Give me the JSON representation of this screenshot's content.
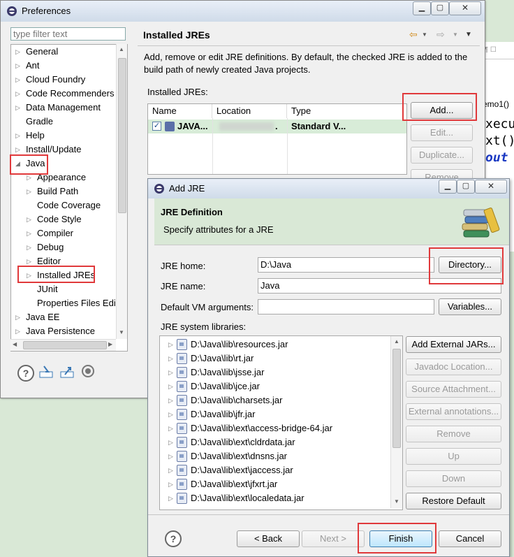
{
  "background_editor": {
    "code_lines": [
      "emo1()",
      "xecu",
      "xt()",
      "out"
    ]
  },
  "prefs": {
    "title": "Preferences",
    "filter_placeholder": "type filter text",
    "page_title": "Installed JREs",
    "description": "Add, remove or edit JRE definitions. By default, the checked JRE is added to the build path of newly created Java projects.",
    "table_label": "Installed JREs:",
    "columns": [
      "Name",
      "Location",
      "Type"
    ],
    "row": {
      "name": "JAVA...",
      "location": ".",
      "type": "Standard V..."
    },
    "buttons": {
      "add": "Add...",
      "edit": "Edit...",
      "duplicate": "Duplicate...",
      "remove": "Remove"
    },
    "tree": [
      {
        "label": "General",
        "level": 0,
        "arrow": "right"
      },
      {
        "label": "Ant",
        "level": 0,
        "arrow": "right"
      },
      {
        "label": "Cloud Foundry",
        "level": 0,
        "arrow": "right"
      },
      {
        "label": "Code Recommenders",
        "level": 0,
        "arrow": "right"
      },
      {
        "label": "Data Management",
        "level": 0,
        "arrow": "right"
      },
      {
        "label": "Gradle",
        "level": 0,
        "arrow": "none"
      },
      {
        "label": "Help",
        "level": 0,
        "arrow": "right"
      },
      {
        "label": "Install/Update",
        "level": 0,
        "arrow": "right"
      },
      {
        "label": "Java",
        "level": 0,
        "arrow": "down"
      },
      {
        "label": "Appearance",
        "level": 1,
        "arrow": "right"
      },
      {
        "label": "Build Path",
        "level": 1,
        "arrow": "right"
      },
      {
        "label": "Code Coverage",
        "level": 1,
        "arrow": "none"
      },
      {
        "label": "Code Style",
        "level": 1,
        "arrow": "right"
      },
      {
        "label": "Compiler",
        "level": 1,
        "arrow": "right"
      },
      {
        "label": "Debug",
        "level": 1,
        "arrow": "right"
      },
      {
        "label": "Editor",
        "level": 1,
        "arrow": "right"
      },
      {
        "label": "Installed JREs",
        "level": 1,
        "arrow": "right"
      },
      {
        "label": "JUnit",
        "level": 1,
        "arrow": "none"
      },
      {
        "label": "Properties Files Edi",
        "level": 1,
        "arrow": "none"
      },
      {
        "label": "Java EE",
        "level": 0,
        "arrow": "right"
      },
      {
        "label": "Java Persistence",
        "level": 0,
        "arrow": "right"
      }
    ]
  },
  "dialog": {
    "title": "Add JRE",
    "header_title": "JRE Definition",
    "header_subtitle": "Specify attributes for a JRE",
    "jre_home_label": "JRE home:",
    "jre_home_value": "D:\\Java",
    "jre_name_label": "JRE name:",
    "jre_name_value": "Java",
    "vm_args_label": "Default VM arguments:",
    "vm_args_value": "",
    "libs_label": "JRE system libraries:",
    "buttons": {
      "directory": "Directory...",
      "variables": "Variables...",
      "add_external": "Add External JARs...",
      "javadoc": "Javadoc Location...",
      "source": "Source Attachment...",
      "annotations": "External annotations...",
      "remove": "Remove",
      "up": "Up",
      "down": "Down",
      "restore": "Restore Default",
      "back": "< Back",
      "next": "Next >",
      "finish": "Finish",
      "cancel": "Cancel"
    },
    "libraries": [
      "D:\\Java\\lib\\resources.jar",
      "D:\\Java\\lib\\rt.jar",
      "D:\\Java\\lib\\jsse.jar",
      "D:\\Java\\lib\\jce.jar",
      "D:\\Java\\lib\\charsets.jar",
      "D:\\Java\\lib\\jfr.jar",
      "D:\\Java\\lib\\ext\\access-bridge-64.jar",
      "D:\\Java\\lib\\ext\\cldrdata.jar",
      "D:\\Java\\lib\\ext\\dnsns.jar",
      "D:\\Java\\lib\\ext\\jaccess.jar",
      "D:\\Java\\lib\\ext\\jfxrt.jar",
      "D:\\Java\\lib\\ext\\localedata.jar"
    ]
  },
  "colors": {
    "highlight": "#e0393b",
    "selected_row": "#d8ecd8",
    "header_green": "#d9e8d6"
  }
}
